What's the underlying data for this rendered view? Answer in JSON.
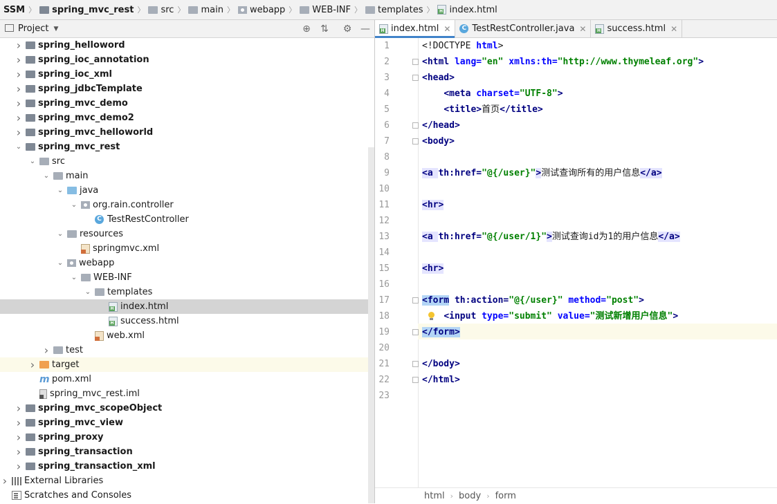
{
  "breadcrumb": [
    {
      "label": "SSM",
      "bold": true,
      "icon": "none"
    },
    {
      "label": "spring_mvc_rest",
      "bold": true,
      "icon": "module-folder-icon"
    },
    {
      "label": "src",
      "icon": "folder-icon"
    },
    {
      "label": "main",
      "icon": "folder-icon"
    },
    {
      "label": "webapp",
      "icon": "web-folder-icon"
    },
    {
      "label": "WEB-INF",
      "icon": "folder-icon"
    },
    {
      "label": "templates",
      "icon": "folder-icon"
    },
    {
      "label": "index.html",
      "icon": "html-file-icon"
    }
  ],
  "project_panel": {
    "title": "Project",
    "tree": [
      {
        "label": "spring_helloword",
        "bold": true,
        "arrow": "right",
        "icon": "module"
      },
      {
        "label": "spring_ioc_annotation",
        "bold": true,
        "arrow": "right",
        "icon": "module"
      },
      {
        "label": "spring_ioc_xml",
        "bold": true,
        "arrow": "right",
        "icon": "module"
      },
      {
        "label": "spring_jdbcTemplate",
        "bold": true,
        "arrow": "right",
        "icon": "module"
      },
      {
        "label": "spring_mvc_demo",
        "bold": true,
        "arrow": "right",
        "icon": "module"
      },
      {
        "label": "spring_mvc_demo2",
        "bold": true,
        "arrow": "right",
        "icon": "module"
      },
      {
        "label": "spring_mvc_helloworld",
        "bold": true,
        "arrow": "right",
        "icon": "module"
      },
      {
        "label": "spring_mvc_rest",
        "bold": true,
        "arrow": "down",
        "icon": "module"
      },
      {
        "label": "src",
        "arrow": "down",
        "icon": "folder"
      },
      {
        "label": "main",
        "arrow": "down",
        "icon": "folder"
      },
      {
        "label": "java",
        "arrow": "down",
        "icon": "source-folder"
      },
      {
        "label": "org.rain.controller",
        "arrow": "down",
        "icon": "package"
      },
      {
        "label": "TestRestController",
        "arrow": "none",
        "icon": "java-class"
      },
      {
        "label": "resources",
        "arrow": "down",
        "icon": "resources-folder"
      },
      {
        "label": "springmvc.xml",
        "arrow": "none",
        "icon": "xml"
      },
      {
        "label": "webapp",
        "arrow": "down",
        "icon": "web-folder"
      },
      {
        "label": "WEB-INF",
        "arrow": "down",
        "icon": "folder"
      },
      {
        "label": "templates",
        "arrow": "down",
        "icon": "folder"
      },
      {
        "label": "index.html",
        "arrow": "none",
        "icon": "html",
        "selected": true
      },
      {
        "label": "success.html",
        "arrow": "none",
        "icon": "html"
      },
      {
        "label": "web.xml",
        "arrow": "none",
        "icon": "xml"
      },
      {
        "label": "test",
        "arrow": "right",
        "icon": "folder"
      },
      {
        "label": "target",
        "arrow": "right",
        "icon": "excluded-folder",
        "highlight": true
      },
      {
        "label": "pom.xml",
        "arrow": "none",
        "icon": "maven"
      },
      {
        "label": "spring_mvc_rest.iml",
        "arrow": "none",
        "icon": "iml"
      },
      {
        "label": "spring_mvc_scopeObject",
        "bold": true,
        "arrow": "right",
        "icon": "module"
      },
      {
        "label": "spring_mvc_view",
        "bold": true,
        "arrow": "right",
        "icon": "module"
      },
      {
        "label": "spring_proxy",
        "bold": true,
        "arrow": "right",
        "icon": "module"
      },
      {
        "label": "spring_transaction",
        "bold": true,
        "arrow": "right",
        "icon": "module"
      },
      {
        "label": "spring_transaction_xml",
        "bold": true,
        "arrow": "right",
        "icon": "module"
      },
      {
        "label": "External Libraries",
        "arrow": "right",
        "icon": "libraries"
      },
      {
        "label": "Scratches and Consoles",
        "arrow": "none",
        "icon": "scratches"
      }
    ]
  },
  "editor_tabs": [
    {
      "label": "index.html",
      "icon": "html",
      "active": true
    },
    {
      "label": "TestRestController.java",
      "icon": "java"
    },
    {
      "label": "success.html",
      "icon": "html"
    }
  ],
  "editor": {
    "line_numbers": [
      "1",
      "2",
      "3",
      "4",
      "5",
      "6",
      "7",
      "8",
      "9",
      "10",
      "11",
      "12",
      "13",
      "14",
      "15",
      "16",
      "17",
      "18",
      "19",
      "20",
      "21",
      "22",
      "23"
    ],
    "current_line": 19,
    "lines": [
      [
        {
          "t": "<!DOCTYPE ",
          "c": "plain"
        },
        {
          "t": "html",
          "c": "attr"
        },
        {
          "t": ">",
          "c": "plain"
        }
      ],
      [
        {
          "t": "<html ",
          "c": "tag"
        },
        {
          "t": "lang=",
          "c": "attr"
        },
        {
          "t": "\"en\" ",
          "c": "str"
        },
        {
          "t": "xmlns:th=",
          "c": "attr"
        },
        {
          "t": "\"http://www.thymeleaf.org\"",
          "c": "str"
        },
        {
          "t": ">",
          "c": "tag"
        }
      ],
      [
        {
          "t": "<head>",
          "c": "tag"
        }
      ],
      [
        {
          "t": "    ",
          "c": "plain"
        },
        {
          "t": "<meta ",
          "c": "tag"
        },
        {
          "t": "charset=",
          "c": "attr"
        },
        {
          "t": "\"UTF-8\"",
          "c": "str"
        },
        {
          "t": ">",
          "c": "tag"
        }
      ],
      [
        {
          "t": "    ",
          "c": "plain"
        },
        {
          "t": "<title>",
          "c": "tag"
        },
        {
          "t": "首页",
          "c": "plain"
        },
        {
          "t": "</title>",
          "c": "tag"
        }
      ],
      [
        {
          "t": "</head>",
          "c": "tag"
        }
      ],
      [
        {
          "t": "<body>",
          "c": "tag"
        }
      ],
      [],
      [
        {
          "t": "<a ",
          "c": "tagbg"
        },
        {
          "t": "th:href=",
          "c": "thx"
        },
        {
          "t": "\"@{/user}\"",
          "c": "str"
        },
        {
          "t": ">",
          "c": "tagbg"
        },
        {
          "t": "测试查询所有的用户信息",
          "c": "plain"
        },
        {
          "t": "</a>",
          "c": "tagbg"
        }
      ],
      [],
      [
        {
          "t": "<hr>",
          "c": "tagbg"
        }
      ],
      [],
      [
        {
          "t": "<a ",
          "c": "tagbg"
        },
        {
          "t": "th:href=",
          "c": "thx"
        },
        {
          "t": "\"@{/user/1}\"",
          "c": "str"
        },
        {
          "t": ">",
          "c": "tagbg"
        },
        {
          "t": "测试查询id为1的用户信息",
          "c": "plain"
        },
        {
          "t": "</a>",
          "c": "tagbg"
        }
      ],
      [],
      [
        {
          "t": "<hr>",
          "c": "tagbg"
        }
      ],
      [],
      [
        {
          "t": "<form",
          "c": "seltag"
        },
        {
          "t": " ",
          "c": "plain"
        },
        {
          "t": "th:action=",
          "c": "thx"
        },
        {
          "t": "\"@{/user}\" ",
          "c": "str"
        },
        {
          "t": "method=",
          "c": "attr"
        },
        {
          "t": "\"post\"",
          "c": "str"
        },
        {
          "t": ">",
          "c": "tag"
        }
      ],
      [
        {
          "t": "    ",
          "c": "plain"
        },
        {
          "t": "<input ",
          "c": "tag"
        },
        {
          "t": "type=",
          "c": "attr"
        },
        {
          "t": "\"submit\" ",
          "c": "str"
        },
        {
          "t": "value=",
          "c": "attr"
        },
        {
          "t": "\"测试新增用户信息\"",
          "c": "str"
        },
        {
          "t": ">",
          "c": "tag"
        }
      ],
      [
        {
          "t": "</form>",
          "c": "seltag"
        }
      ],
      [],
      [
        {
          "t": "</body>",
          "c": "tag"
        }
      ],
      [
        {
          "t": "</html>",
          "c": "tag"
        }
      ],
      []
    ]
  },
  "status_breadcrumb": [
    "html",
    "body",
    "form"
  ],
  "colors": {
    "accent": "#4083c9",
    "selection": "#b3d5f5",
    "tag": "#000080",
    "attribute": "#0000ff",
    "string": "#008000"
  }
}
